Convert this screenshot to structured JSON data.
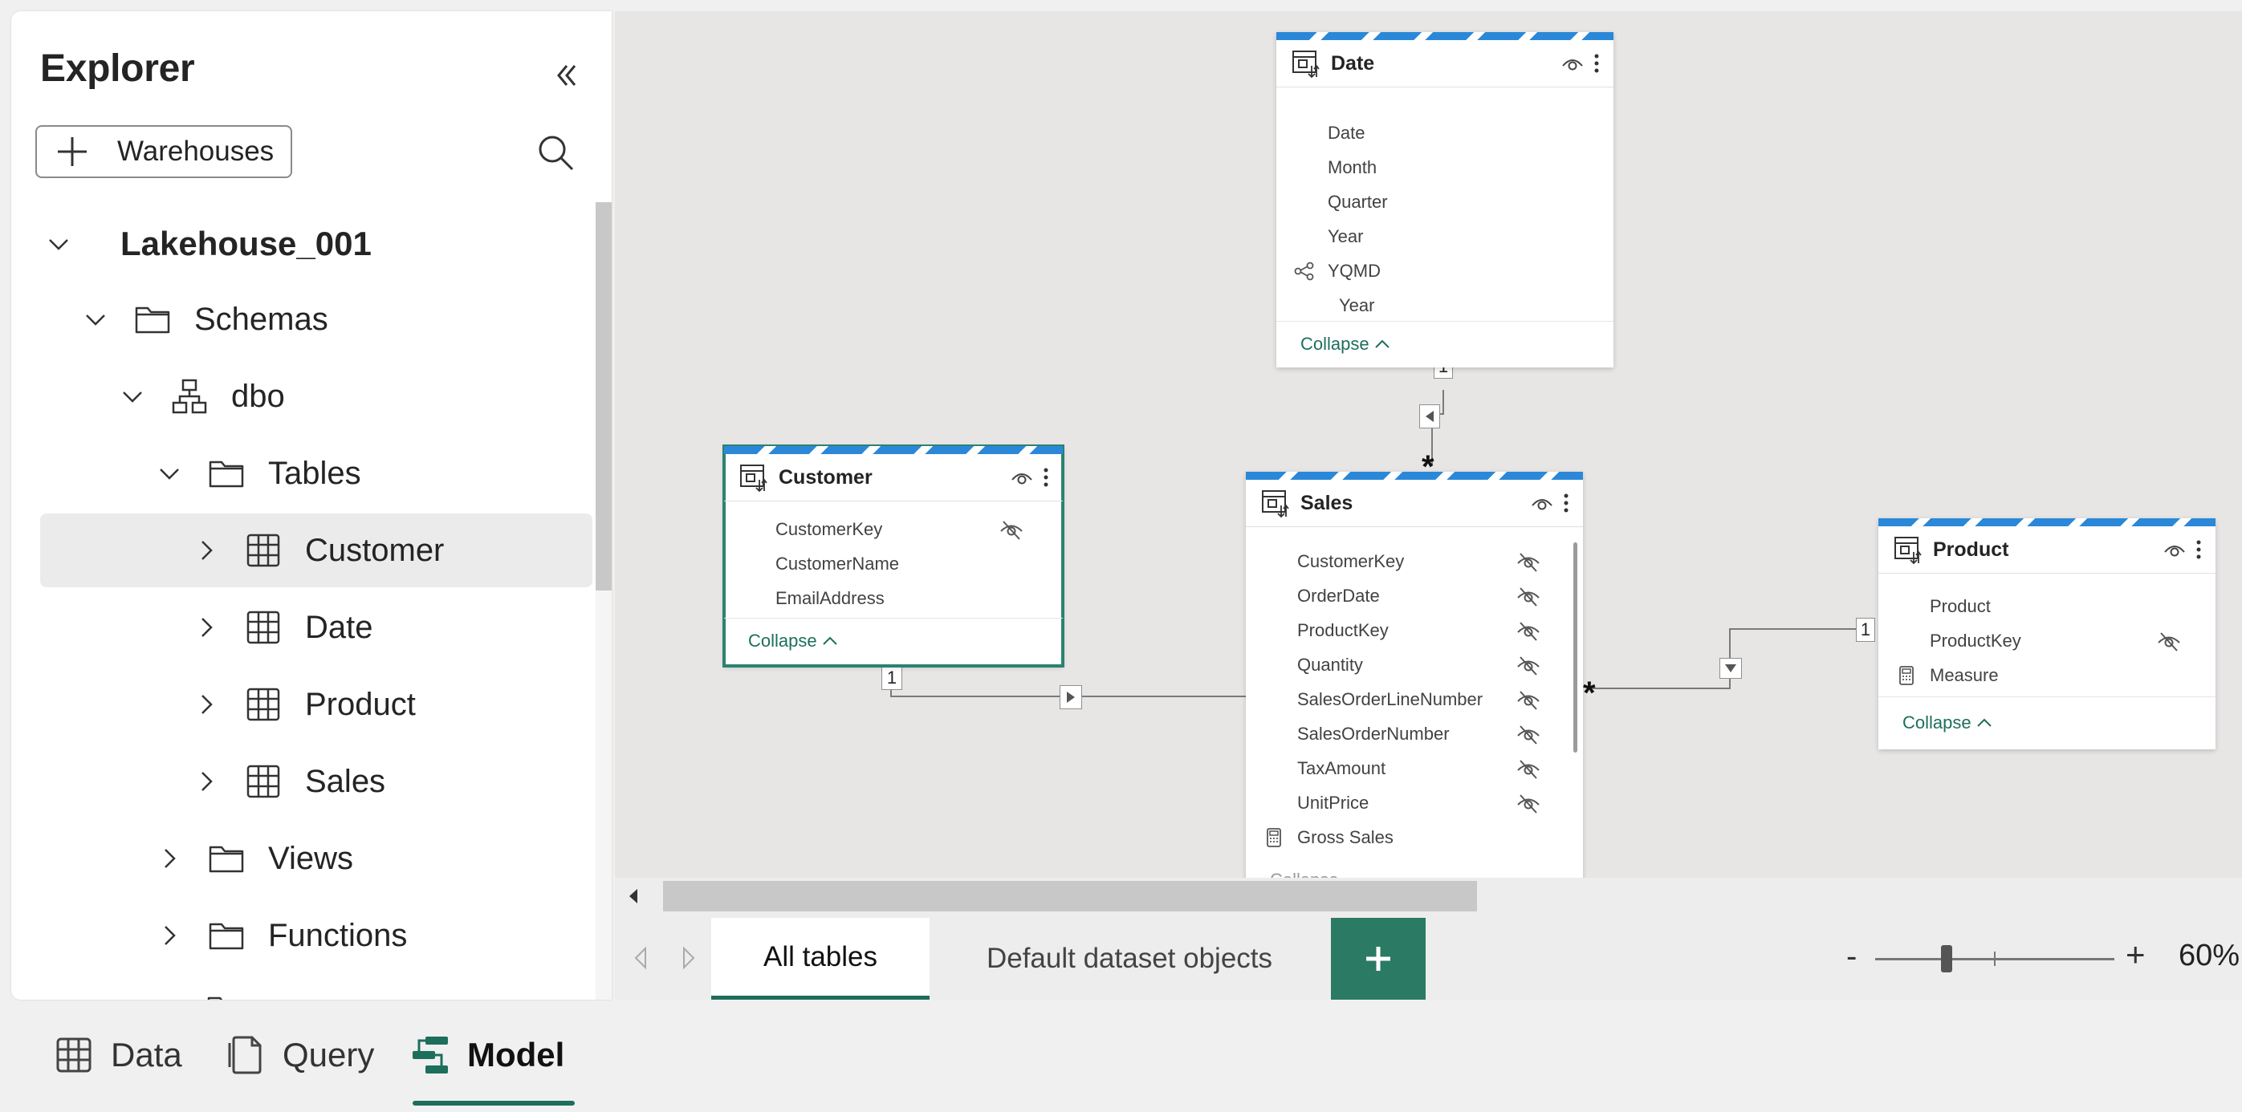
{
  "explorer": {
    "title": "Explorer",
    "warehouses_label": "Warehouses",
    "tree": [
      {
        "label": "Lakehouse_001",
        "icon": "none"
      },
      {
        "label": "Schemas",
        "icon": "folder-icon"
      },
      {
        "label": "dbo",
        "icon": "schema-icon"
      },
      {
        "label": "Tables",
        "icon": "folder-icon"
      },
      {
        "label": "Customer",
        "icon": "table-icon",
        "selected": true
      },
      {
        "label": "Date",
        "icon": "table-icon"
      },
      {
        "label": "Product",
        "icon": "table-icon"
      },
      {
        "label": "Sales",
        "icon": "table-icon"
      },
      {
        "label": "Views",
        "icon": "folder-icon"
      },
      {
        "label": "Functions",
        "icon": "folder-icon"
      }
    ]
  },
  "model": {
    "date": {
      "title": "Date",
      "fields": [
        "Date",
        "Month",
        "Quarter",
        "Year"
      ],
      "hierarchy": {
        "name": "YQMD",
        "level": "Year"
      },
      "collapse": "Collapse"
    },
    "customer": {
      "title": "Customer",
      "fields": [
        "CustomerKey",
        "CustomerName",
        "EmailAddress"
      ],
      "collapse": "Collapse"
    },
    "sales": {
      "title": "Sales",
      "fields": [
        "CustomerKey",
        "OrderDate",
        "ProductKey",
        "Quantity",
        "SalesOrderLineNumber",
        "SalesOrderNumber",
        "TaxAmount",
        "UnitPrice"
      ],
      "measure": "Gross Sales",
      "collapse": "Collapse"
    },
    "product": {
      "title": "Product",
      "fields": [
        "Product",
        "ProductKey"
      ],
      "measure": "Measure",
      "collapse": "Collapse"
    },
    "relationships": {
      "one": "1",
      "many": "*"
    }
  },
  "tabs": {
    "items": [
      "All tables",
      "Default dataset objects"
    ],
    "add_label": "+"
  },
  "zoom": {
    "minus": "-",
    "plus": "+",
    "value": "60%",
    "level": 0.3
  },
  "views": {
    "items": [
      "Data",
      "Query",
      "Model"
    ],
    "active": "Model"
  },
  "colors": {
    "accent": "#1d6f5c",
    "stripe": "#2b88d8",
    "add_tab": "#2b7a63"
  }
}
